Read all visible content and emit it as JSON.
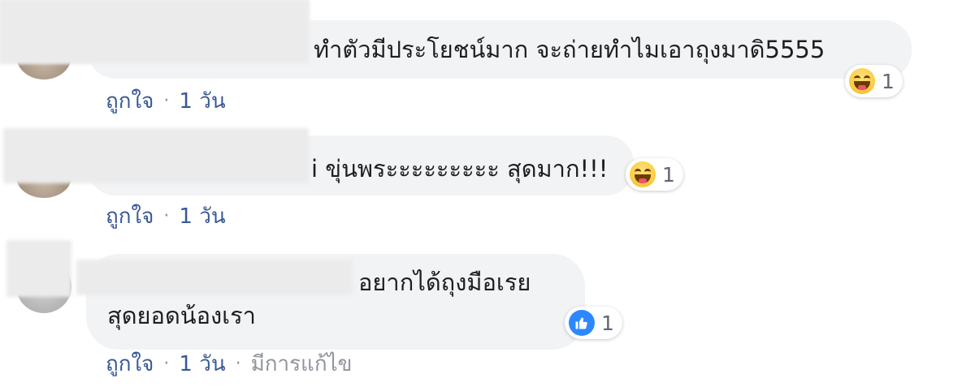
{
  "comments": [
    {
      "author": "",
      "text": "ทำตัวมีประโยชน์มาก จะถ่ายทำไมเอาถุงมาดิ5555",
      "reaction": {
        "type": "haha",
        "icon": "haha-icon",
        "count": "1"
      },
      "meta": {
        "like": "ถูกใจ",
        "sep": "·",
        "time": "1 วัน"
      }
    },
    {
      "author": "",
      "text": "i ขุ่นพระะะะะะะะะ สุดมาก!!!",
      "reaction": {
        "type": "haha",
        "icon": "haha-icon",
        "count": "1"
      },
      "meta": {
        "like": "ถูกใจ",
        "sep": "·",
        "time": "1 วัน"
      }
    },
    {
      "author": "",
      "text_line1": "อยากได้ถุงมือเรย",
      "text_line2": "สุดยอดน้องเรา",
      "reaction": {
        "type": "like",
        "icon": "thumbs-up-icon",
        "count": "1"
      },
      "meta": {
        "like": "ถูกใจ",
        "sep": "·",
        "time": "1 วัน",
        "sep2": "·",
        "edited": "มีการแก้ไข"
      }
    }
  ],
  "colors": {
    "bubble": "#f2f3f5",
    "link": "#385898",
    "muted": "#90949c",
    "like_blue": "#2d88ff"
  }
}
